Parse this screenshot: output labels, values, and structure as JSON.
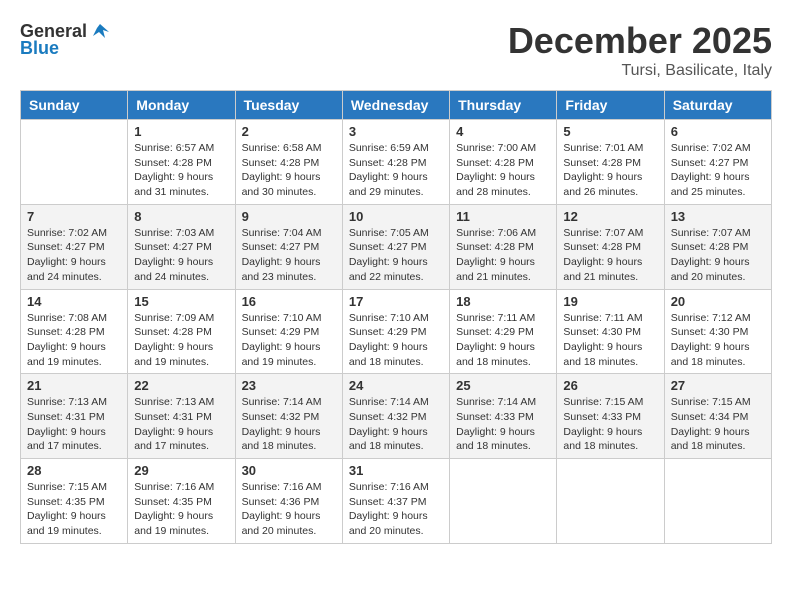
{
  "logo": {
    "general": "General",
    "blue": "Blue"
  },
  "title": {
    "month": "December 2025",
    "location": "Tursi, Basilicate, Italy"
  },
  "headers": [
    "Sunday",
    "Monday",
    "Tuesday",
    "Wednesday",
    "Thursday",
    "Friday",
    "Saturday"
  ],
  "weeks": [
    [
      {
        "day": "",
        "info": ""
      },
      {
        "day": "1",
        "info": "Sunrise: 6:57 AM\nSunset: 4:28 PM\nDaylight: 9 hours\nand 31 minutes."
      },
      {
        "day": "2",
        "info": "Sunrise: 6:58 AM\nSunset: 4:28 PM\nDaylight: 9 hours\nand 30 minutes."
      },
      {
        "day": "3",
        "info": "Sunrise: 6:59 AM\nSunset: 4:28 PM\nDaylight: 9 hours\nand 29 minutes."
      },
      {
        "day": "4",
        "info": "Sunrise: 7:00 AM\nSunset: 4:28 PM\nDaylight: 9 hours\nand 28 minutes."
      },
      {
        "day": "5",
        "info": "Sunrise: 7:01 AM\nSunset: 4:28 PM\nDaylight: 9 hours\nand 26 minutes."
      },
      {
        "day": "6",
        "info": "Sunrise: 7:02 AM\nSunset: 4:27 PM\nDaylight: 9 hours\nand 25 minutes."
      }
    ],
    [
      {
        "day": "7",
        "info": "Sunrise: 7:02 AM\nSunset: 4:27 PM\nDaylight: 9 hours\nand 24 minutes."
      },
      {
        "day": "8",
        "info": "Sunrise: 7:03 AM\nSunset: 4:27 PM\nDaylight: 9 hours\nand 24 minutes."
      },
      {
        "day": "9",
        "info": "Sunrise: 7:04 AM\nSunset: 4:27 PM\nDaylight: 9 hours\nand 23 minutes."
      },
      {
        "day": "10",
        "info": "Sunrise: 7:05 AM\nSunset: 4:27 PM\nDaylight: 9 hours\nand 22 minutes."
      },
      {
        "day": "11",
        "info": "Sunrise: 7:06 AM\nSunset: 4:28 PM\nDaylight: 9 hours\nand 21 minutes."
      },
      {
        "day": "12",
        "info": "Sunrise: 7:07 AM\nSunset: 4:28 PM\nDaylight: 9 hours\nand 21 minutes."
      },
      {
        "day": "13",
        "info": "Sunrise: 7:07 AM\nSunset: 4:28 PM\nDaylight: 9 hours\nand 20 minutes."
      }
    ],
    [
      {
        "day": "14",
        "info": "Sunrise: 7:08 AM\nSunset: 4:28 PM\nDaylight: 9 hours\nand 19 minutes."
      },
      {
        "day": "15",
        "info": "Sunrise: 7:09 AM\nSunset: 4:28 PM\nDaylight: 9 hours\nand 19 minutes."
      },
      {
        "day": "16",
        "info": "Sunrise: 7:10 AM\nSunset: 4:29 PM\nDaylight: 9 hours\nand 19 minutes."
      },
      {
        "day": "17",
        "info": "Sunrise: 7:10 AM\nSunset: 4:29 PM\nDaylight: 9 hours\nand 18 minutes."
      },
      {
        "day": "18",
        "info": "Sunrise: 7:11 AM\nSunset: 4:29 PM\nDaylight: 9 hours\nand 18 minutes."
      },
      {
        "day": "19",
        "info": "Sunrise: 7:11 AM\nSunset: 4:30 PM\nDaylight: 9 hours\nand 18 minutes."
      },
      {
        "day": "20",
        "info": "Sunrise: 7:12 AM\nSunset: 4:30 PM\nDaylight: 9 hours\nand 18 minutes."
      }
    ],
    [
      {
        "day": "21",
        "info": "Sunrise: 7:13 AM\nSunset: 4:31 PM\nDaylight: 9 hours\nand 17 minutes."
      },
      {
        "day": "22",
        "info": "Sunrise: 7:13 AM\nSunset: 4:31 PM\nDaylight: 9 hours\nand 17 minutes."
      },
      {
        "day": "23",
        "info": "Sunrise: 7:14 AM\nSunset: 4:32 PM\nDaylight: 9 hours\nand 18 minutes."
      },
      {
        "day": "24",
        "info": "Sunrise: 7:14 AM\nSunset: 4:32 PM\nDaylight: 9 hours\nand 18 minutes."
      },
      {
        "day": "25",
        "info": "Sunrise: 7:14 AM\nSunset: 4:33 PM\nDaylight: 9 hours\nand 18 minutes."
      },
      {
        "day": "26",
        "info": "Sunrise: 7:15 AM\nSunset: 4:33 PM\nDaylight: 9 hours\nand 18 minutes."
      },
      {
        "day": "27",
        "info": "Sunrise: 7:15 AM\nSunset: 4:34 PM\nDaylight: 9 hours\nand 18 minutes."
      }
    ],
    [
      {
        "day": "28",
        "info": "Sunrise: 7:15 AM\nSunset: 4:35 PM\nDaylight: 9 hours\nand 19 minutes."
      },
      {
        "day": "29",
        "info": "Sunrise: 7:16 AM\nSunset: 4:35 PM\nDaylight: 9 hours\nand 19 minutes."
      },
      {
        "day": "30",
        "info": "Sunrise: 7:16 AM\nSunset: 4:36 PM\nDaylight: 9 hours\nand 20 minutes."
      },
      {
        "day": "31",
        "info": "Sunrise: 7:16 AM\nSunset: 4:37 PM\nDaylight: 9 hours\nand 20 minutes."
      },
      {
        "day": "",
        "info": ""
      },
      {
        "day": "",
        "info": ""
      },
      {
        "day": "",
        "info": ""
      }
    ]
  ]
}
